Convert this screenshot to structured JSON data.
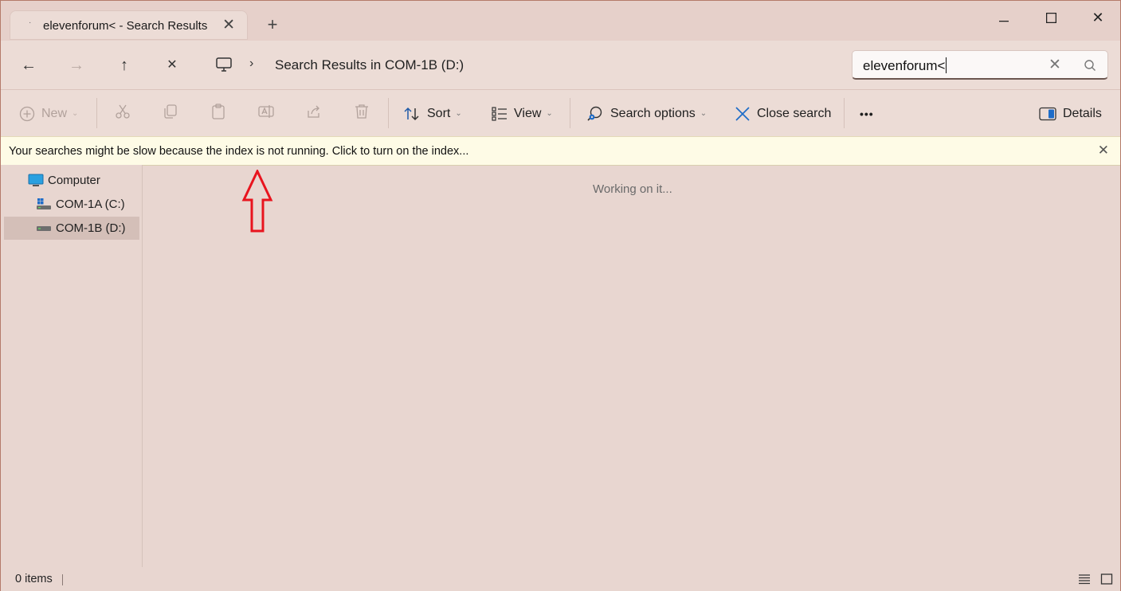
{
  "tab": {
    "title": "elevenforum< - Search Results",
    "close_glyph": "✕"
  },
  "titlebar": {
    "new_tab_glyph": "+",
    "minimize_glyph": "—",
    "maximize_glyph": "☐",
    "close_glyph": "✕"
  },
  "nav": {
    "back_glyph": "←",
    "forward_glyph": "→",
    "up_glyph": "↑",
    "stop_glyph": "✕",
    "breadcrumb_sep": "›",
    "breadcrumb_text": "Search Results in COM-1B (D:)"
  },
  "search": {
    "value": "elevenforum<",
    "clear_glyph": "✕"
  },
  "toolbar": {
    "new_label": "New",
    "sort_label": "Sort",
    "view_label": "View",
    "search_options_label": "Search options",
    "close_search_label": "Close search",
    "more_label": "•••",
    "details_label": "Details",
    "chevron": "⌄"
  },
  "infobar": {
    "message": "Your searches might be slow because the index is not running.  Click to turn on the index...",
    "close_glyph": "✕"
  },
  "sidebar": {
    "items": [
      {
        "label": "Computer"
      },
      {
        "label": "COM-1A (C:)"
      },
      {
        "label": "COM-1B (D:)"
      }
    ]
  },
  "content": {
    "status": "Working on it..."
  },
  "status": {
    "item_count": "0 items"
  },
  "colors": {
    "annotation_arrow": "#e8141e",
    "accent": "#0a64c8"
  },
  "icons": {
    "monitor": "monitor-icon",
    "search": "search-icon",
    "cut": "scissors-icon",
    "copy": "copy-icon",
    "paste": "clipboard-icon",
    "rename": "rename-icon",
    "share": "share-icon",
    "delete": "trash-icon",
    "sort": "sort-icon",
    "view": "view-list-icon",
    "search_options": "search-options-icon",
    "details": "details-pane-icon"
  }
}
